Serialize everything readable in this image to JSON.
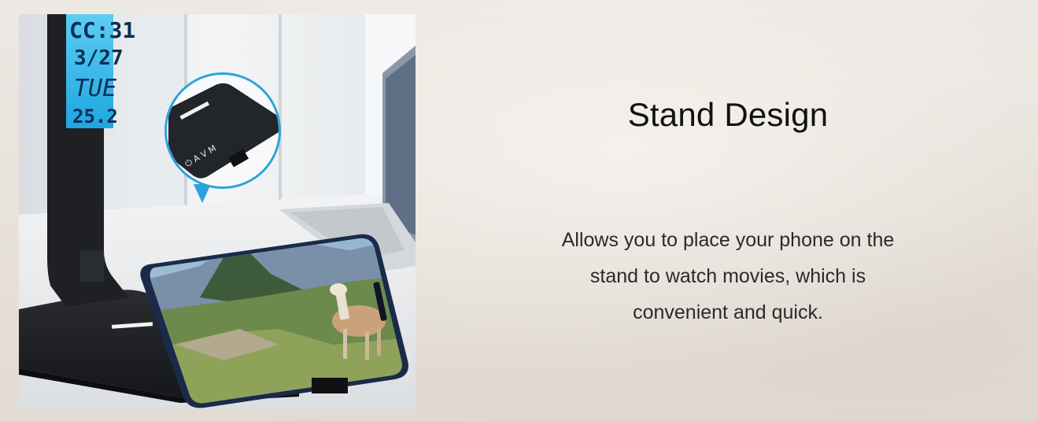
{
  "feature": {
    "title": "Stand Design",
    "description": "Allows you to place your phone on the stand to watch movies, which is convenient and quick."
  },
  "product_photo": {
    "display": {
      "time": "CC:31",
      "date": "3/27",
      "day": "TUE",
      "temperature": "25.2"
    },
    "button_labels": [
      "⏻",
      "A",
      "V",
      "M"
    ]
  },
  "colors": {
    "background": "#e8e3dd",
    "lcd_blue": "#2fb5e8",
    "lamp_black": "#1d1f22",
    "accent_pointer": "#29a3dc"
  }
}
